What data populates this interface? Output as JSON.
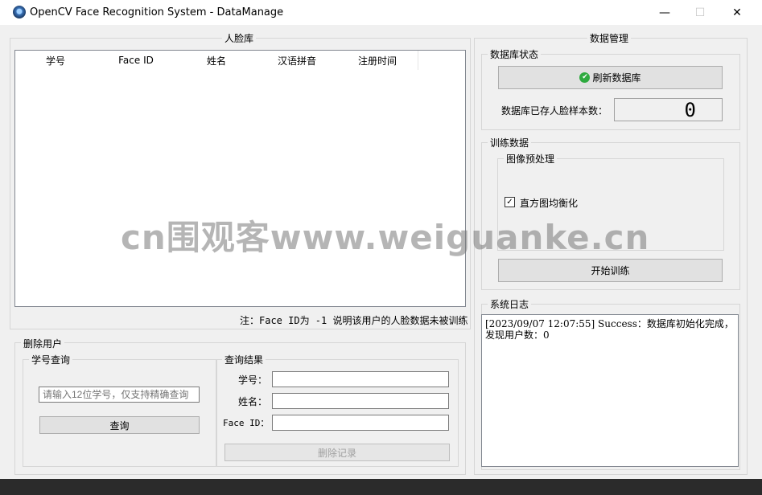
{
  "window": {
    "title": "OpenCV Face Recognition System - DataManage",
    "minimize": "—",
    "maximize": "☐",
    "close": "✕"
  },
  "face_db": {
    "title": "人脸库",
    "columns": [
      "学号",
      "Face ID",
      "姓名",
      "汉语拼音",
      "注册时间"
    ],
    "note": "注：Face ID为 -1 说明该用户的人脸数据未被训练"
  },
  "delete_user": {
    "title": "删除用户",
    "query_group": "学号查询",
    "query_placeholder": "请输入12位学号，仅支持精确查询",
    "query_button": "查询",
    "result_group": "查询结果",
    "labels": {
      "student_id": "学号：",
      "name": "姓名：",
      "face_id": "Face ID："
    },
    "delete_button": "删除记录"
  },
  "data_manage": {
    "title": "数据管理",
    "db_status": "数据库状态",
    "refresh_button": "刷新数据库",
    "sample_count_label": "数据库已存人脸样本数：",
    "sample_count": "0",
    "train_group": "训练数据",
    "preprocess_group": "图像预处理",
    "equalize_checkbox": "直方图均衡化",
    "equalize_checked": true,
    "train_button": "开始训练",
    "log_group": "系统日志",
    "log_text": "[2023/09/07 12:07:55] Success：数据库初始化完成，发现用户数：0"
  },
  "watermark": "cn围观客www.weiguanke.cn",
  "colors": {
    "success": "#2eaa3f"
  }
}
